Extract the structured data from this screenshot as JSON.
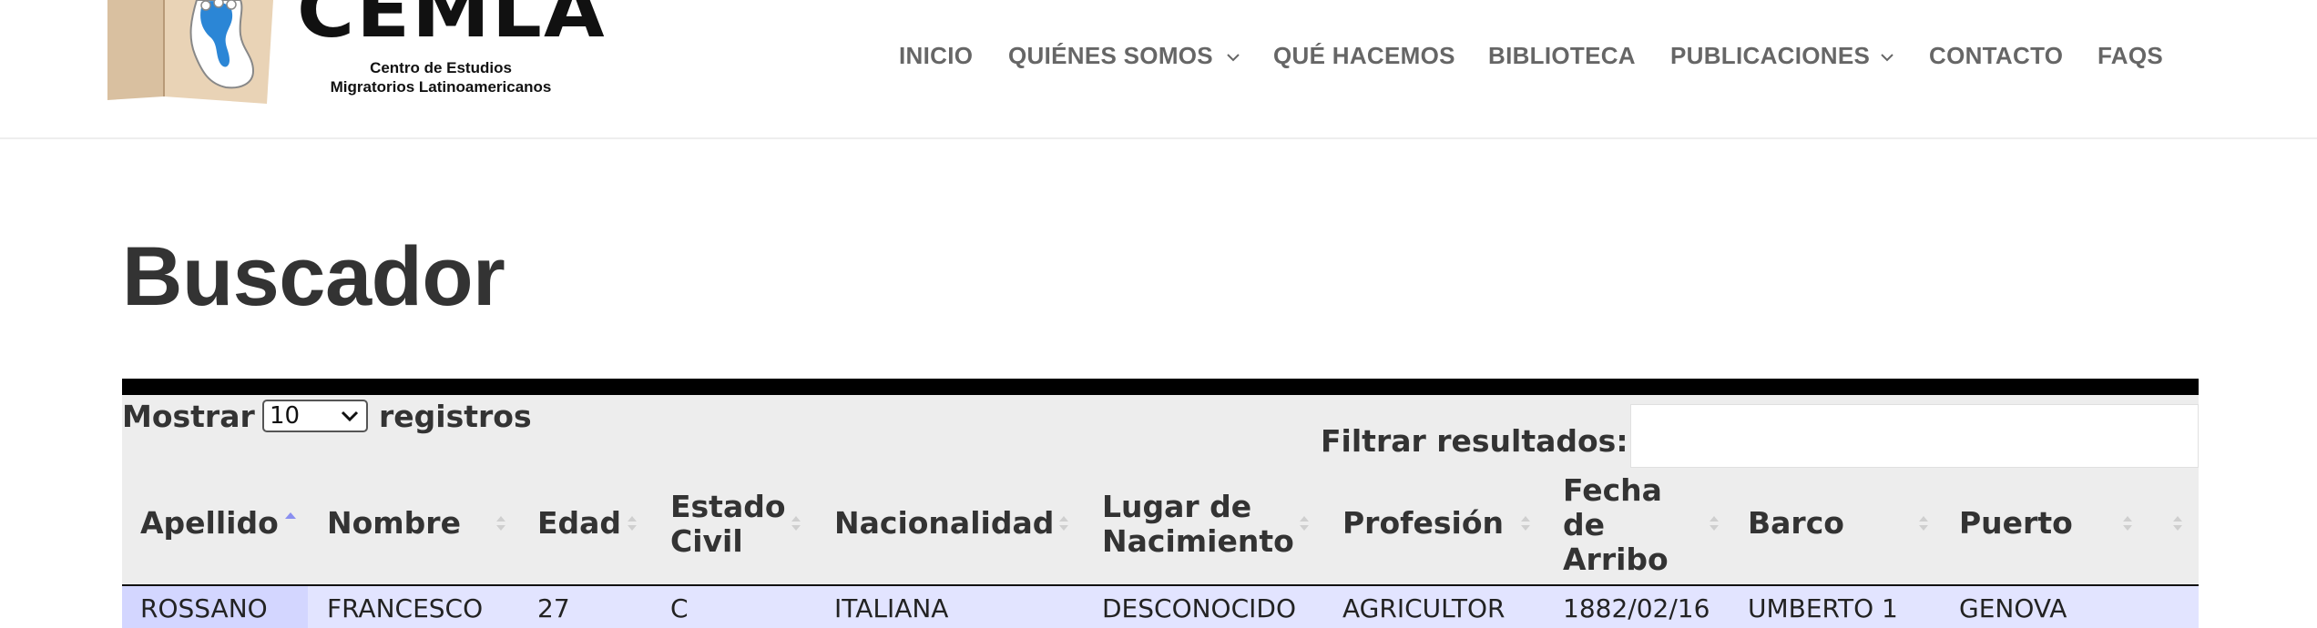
{
  "logo": {
    "name": "CEMLA",
    "subtitle_line1": "Centro de Estudios",
    "subtitle_line2": "Migratorios Latinoamericanos"
  },
  "nav": {
    "items": [
      {
        "label": "INICIO"
      },
      {
        "label": "QUIÉNES SOMOS"
      },
      {
        "label": "QUÉ HACEMOS"
      },
      {
        "label": "BIBLIOTECA"
      },
      {
        "label": "PUBLICACIONES"
      },
      {
        "label": "CONTACTO"
      },
      {
        "label": "FAQS"
      }
    ]
  },
  "page": {
    "title": "Buscador"
  },
  "table": {
    "length_prefix": "Mostrar",
    "length_value": "10",
    "length_suffix": "registros",
    "filter_label": "Filtrar resultados:",
    "filter_value": "",
    "columns": [
      {
        "line1": "Apellido",
        "line2": "",
        "line3": "",
        "sort": "asc"
      },
      {
        "line1": "Nombre",
        "line2": "",
        "line3": "",
        "sort": "none"
      },
      {
        "line1": "Edad",
        "line2": "",
        "line3": "",
        "sort": "none"
      },
      {
        "line1": "Estado",
        "line2": "Civil",
        "line3": "",
        "sort": "none"
      },
      {
        "line1": "Nacionalidad",
        "line2": "",
        "line3": "",
        "sort": "none"
      },
      {
        "line1": "Lugar de",
        "line2": "Nacimiento",
        "line3": "",
        "sort": "none"
      },
      {
        "line1": "Profesión",
        "line2": "",
        "line3": "",
        "sort": "none"
      },
      {
        "line1": "Fecha",
        "line2": "de",
        "line3": "Arribo",
        "sort": "none"
      },
      {
        "line1": "Barco",
        "line2": "",
        "line3": "",
        "sort": "none"
      },
      {
        "line1": "Puerto",
        "line2": "",
        "line3": "",
        "sort": "none"
      },
      {
        "line1": "",
        "line2": "",
        "line3": "",
        "sort": "none"
      }
    ],
    "rows": [
      [
        "ROSSANO",
        "FRANCESCO",
        "27",
        "C",
        "ITALIANA",
        "DESCONOCIDO",
        "AGRICULTOR",
        "1882/02/16",
        "UMBERTO 1",
        "GENOVA"
      ]
    ]
  },
  "colors": {
    "nav_text": "#666666",
    "heading": "#333333",
    "table_bg": "#ededed",
    "row_bg": "#e2e4ff",
    "sorted_cell_bg": "#d3d6ff",
    "sort_active": "#8a8ff0",
    "sort_inactive": "#cfcfcf"
  }
}
